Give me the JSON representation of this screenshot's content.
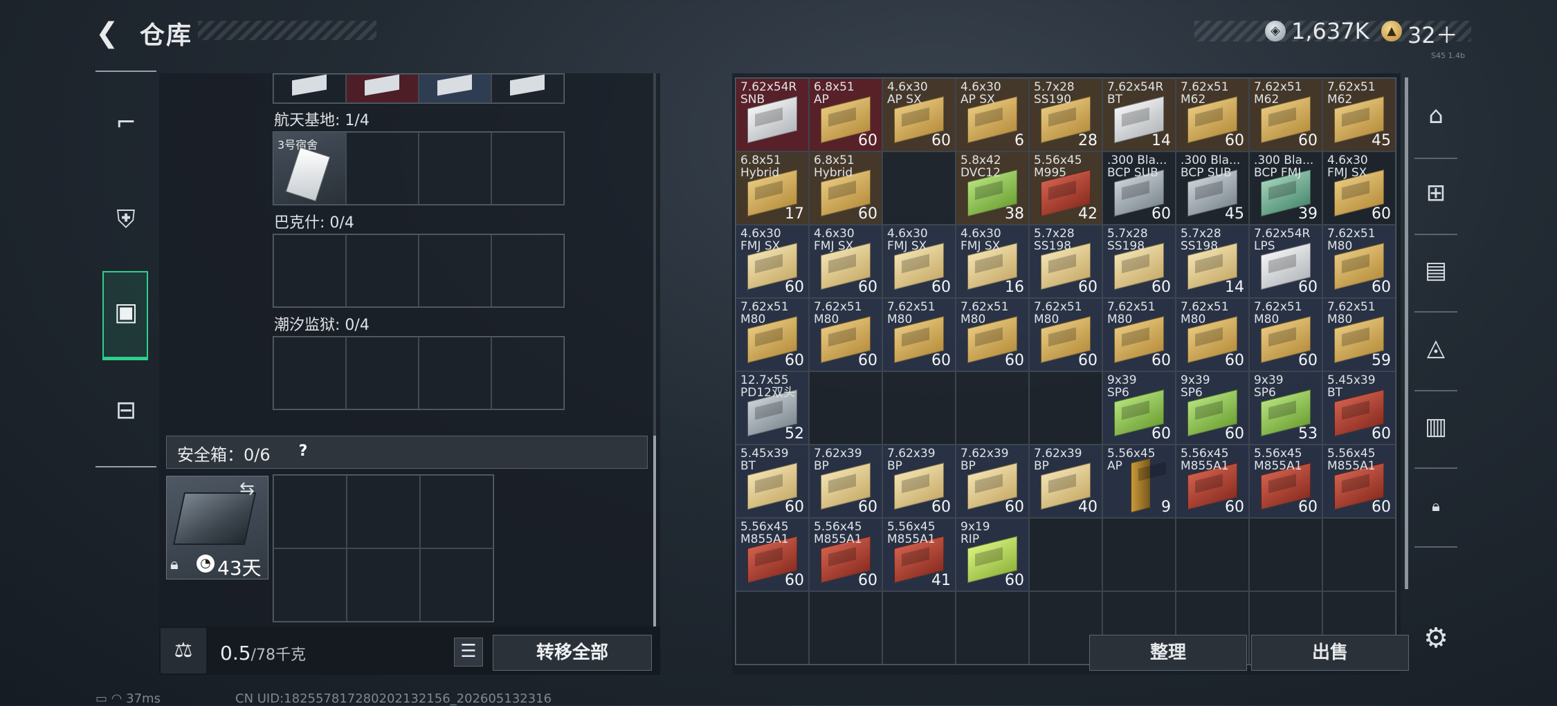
{
  "header": {
    "back_icon": "❮",
    "title": "仓库",
    "currency1_value": "1,637K",
    "currency2_value": "32＋",
    "version_text": "S45 1.4b"
  },
  "sidebar": {
    "items": [
      "weapons",
      "armor",
      "backpack",
      "toolbox"
    ]
  },
  "left_panel": {
    "sections": [
      {
        "label": "航天基地: 1/4"
      },
      {
        "label": "巴克什: 0/4"
      },
      {
        "label": "潮汐监狱: 0/4"
      }
    ],
    "key_item_label": "3号宿舍",
    "safe_box_label": "安全箱：0/6",
    "safe_help": "?",
    "safe_days": "43天",
    "weight_value": "0.5",
    "weight_capacity": "/78千克",
    "transfer_all": "转移全部"
  },
  "ammo_slots": [
    {
      "name": "7.62x54R\nSNB",
      "qty": "",
      "bg": "bg-red",
      "color": "c-white"
    },
    {
      "name": "6.8x51\nAP",
      "qty": "60",
      "bg": "bg-red",
      "color": "c-tan"
    },
    {
      "name": "4.6x30\nAP SX",
      "qty": "60",
      "bg": "bg-brown",
      "color": "c-tan"
    },
    {
      "name": "4.6x30\nAP SX",
      "qty": "6",
      "bg": "bg-brown",
      "color": "c-tan"
    },
    {
      "name": "5.7x28\nSS190",
      "qty": "28",
      "bg": "bg-brown",
      "color": "c-tan"
    },
    {
      "name": "7.62x54R\nBT",
      "qty": "14",
      "bg": "bg-brown",
      "color": "c-white"
    },
    {
      "name": "7.62x51\nM62",
      "qty": "60",
      "bg": "bg-brown",
      "color": "c-tan"
    },
    {
      "name": "7.62x51\nM62",
      "qty": "60",
      "bg": "bg-brown",
      "color": "c-tan"
    },
    {
      "name": "7.62x51\nM62",
      "qty": "45",
      "bg": "bg-brown",
      "color": "c-tan"
    },
    {
      "name": "6.8x51\nHybrid",
      "qty": "17",
      "bg": "bg-brown",
      "color": "c-tan"
    },
    {
      "name": "6.8x51\nHybrid",
      "qty": "60",
      "bg": "bg-brown",
      "color": "c-tan"
    },
    {
      "name": "",
      "qty": "",
      "bg": "bg-dark",
      "color": ""
    },
    {
      "name": "5.8x42\nDVC12",
      "qty": "38",
      "bg": "bg-brown",
      "color": "c-green"
    },
    {
      "name": "5.56x45\nM995",
      "qty": "42",
      "bg": "bg-brown",
      "color": "c-red"
    },
    {
      "name": ".300 Bla...\nBCP SUB",
      "qty": "60",
      "bg": "bg-dark",
      "color": "c-gray"
    },
    {
      "name": ".300 Bla...\nBCP SUB",
      "qty": "45",
      "bg": "bg-dark",
      "color": "c-gray"
    },
    {
      "name": ".300 Bla...\nBCP FMJ",
      "qty": "39",
      "bg": "bg-dark",
      "color": "c-teal"
    },
    {
      "name": "4.6x30\nFMJ SX",
      "qty": "60",
      "bg": "bg-dark",
      "color": "c-tan"
    },
    {
      "name": "4.6x30\nFMJ SX",
      "qty": "60",
      "bg": "bg-blue",
      "color": "c-ltan"
    },
    {
      "name": "4.6x30\nFMJ SX",
      "qty": "60",
      "bg": "bg-blue",
      "color": "c-ltan"
    },
    {
      "name": "4.6x30\nFMJ SX",
      "qty": "60",
      "bg": "bg-blue",
      "color": "c-ltan"
    },
    {
      "name": "4.6x30\nFMJ SX",
      "qty": "16",
      "bg": "bg-blue",
      "color": "c-ltan"
    },
    {
      "name": "5.7x28\nSS198",
      "qty": "60",
      "bg": "bg-blue",
      "color": "c-ltan"
    },
    {
      "name": "5.7x28\nSS198",
      "qty": "60",
      "bg": "bg-blue",
      "color": "c-ltan"
    },
    {
      "name": "5.7x28\nSS198",
      "qty": "14",
      "bg": "bg-blue",
      "color": "c-ltan"
    },
    {
      "name": "7.62x54R\nLPS",
      "qty": "60",
      "bg": "bg-blue",
      "color": "c-white"
    },
    {
      "name": "7.62x51\nM80",
      "qty": "60",
      "bg": "bg-blue",
      "color": "c-tan"
    },
    {
      "name": "7.62x51\nM80",
      "qty": "60",
      "bg": "bg-blue",
      "color": "c-tan"
    },
    {
      "name": "7.62x51\nM80",
      "qty": "60",
      "bg": "bg-blue",
      "color": "c-tan"
    },
    {
      "name": "7.62x51\nM80",
      "qty": "60",
      "bg": "bg-blue",
      "color": "c-tan"
    },
    {
      "name": "7.62x51\nM80",
      "qty": "60",
      "bg": "bg-blue",
      "color": "c-tan"
    },
    {
      "name": "7.62x51\nM80",
      "qty": "60",
      "bg": "bg-blue",
      "color": "c-tan"
    },
    {
      "name": "7.62x51\nM80",
      "qty": "60",
      "bg": "bg-blue",
      "color": "c-tan"
    },
    {
      "name": "7.62x51\nM80",
      "qty": "60",
      "bg": "bg-blue",
      "color": "c-tan"
    },
    {
      "name": "7.62x51\nM80",
      "qty": "60",
      "bg": "bg-blue",
      "color": "c-tan"
    },
    {
      "name": "7.62x51\nM80",
      "qty": "59",
      "bg": "bg-blue",
      "color": "c-tan"
    },
    {
      "name": "12.7x55\nPD12双头",
      "qty": "52",
      "bg": "bg-blue",
      "color": "c-gray"
    },
    {
      "name": "",
      "qty": "",
      "bg": "bg-dark",
      "color": ""
    },
    {
      "name": "",
      "qty": "",
      "bg": "bg-dark",
      "color": ""
    },
    {
      "name": "",
      "qty": "",
      "bg": "bg-dark",
      "color": ""
    },
    {
      "name": "",
      "qty": "",
      "bg": "bg-dark",
      "color": ""
    },
    {
      "name": "9x39\nSP6",
      "qty": "60",
      "bg": "bg-blue",
      "color": "c-green"
    },
    {
      "name": "9x39\nSP6",
      "qty": "60",
      "bg": "bg-blue",
      "color": "c-green"
    },
    {
      "name": "9x39\nSP6",
      "qty": "53",
      "bg": "bg-blue",
      "color": "c-green"
    },
    {
      "name": "5.45x39\nBT",
      "qty": "60",
      "bg": "bg-blue",
      "color": "c-red"
    },
    {
      "name": "5.45x39\nBT",
      "qty": "60",
      "bg": "bg-blue",
      "color": "c-ltan"
    },
    {
      "name": "7.62x39\nBP",
      "qty": "60",
      "bg": "bg-blue",
      "color": "c-ltan"
    },
    {
      "name": "7.62x39\nBP",
      "qty": "60",
      "bg": "bg-blue",
      "color": "c-ltan"
    },
    {
      "name": "7.62x39\nBP",
      "qty": "60",
      "bg": "bg-blue",
      "color": "c-ltan"
    },
    {
      "name": "7.62x39\nBP",
      "qty": "40",
      "bg": "bg-blue",
      "color": "c-ltan"
    },
    {
      "name": "5.56x45\nAP",
      "qty": "9",
      "bg": "bg-blue",
      "color": "c-bullet"
    },
    {
      "name": "5.56x45\nM855A1",
      "qty": "60",
      "bg": "bg-blue",
      "color": "c-red"
    },
    {
      "name": "5.56x45\nM855A1",
      "qty": "60",
      "bg": "bg-blue",
      "color": "c-red"
    },
    {
      "name": "5.56x45\nM855A1",
      "qty": "60",
      "bg": "bg-blue",
      "color": "c-red"
    },
    {
      "name": "5.56x45\nM855A1",
      "qty": "60",
      "bg": "bg-blue",
      "color": "c-red"
    },
    {
      "name": "5.56x45\nM855A1",
      "qty": "60",
      "bg": "bg-blue",
      "color": "c-red"
    },
    {
      "name": "5.56x45\nM855A1",
      "qty": "41",
      "bg": "bg-blue",
      "color": "c-red"
    },
    {
      "name": "9x19\nRIP",
      "qty": "60",
      "bg": "bg-blue",
      "color": "c-lime"
    },
    {
      "name": "",
      "qty": "",
      "bg": "bg-dark",
      "color": ""
    },
    {
      "name": "",
      "qty": "",
      "bg": "bg-dark",
      "color": ""
    },
    {
      "name": "",
      "qty": "",
      "bg": "bg-dark",
      "color": ""
    },
    {
      "name": "",
      "qty": "",
      "bg": "bg-dark",
      "color": ""
    },
    {
      "name": "",
      "qty": "",
      "bg": "bg-dark",
      "color": ""
    },
    {
      "name": "",
      "qty": "",
      "bg": "bg-dark",
      "color": ""
    },
    {
      "name": "",
      "qty": "",
      "bg": "bg-dark",
      "color": ""
    },
    {
      "name": "",
      "qty": "",
      "bg": "bg-dark",
      "color": ""
    },
    {
      "name": "",
      "qty": "",
      "bg": "bg-dark",
      "color": ""
    },
    {
      "name": "",
      "qty": "",
      "bg": "bg-dark",
      "color": ""
    },
    {
      "name": "",
      "qty": "",
      "bg": "bg-dark",
      "color": ""
    },
    {
      "name": "",
      "qty": "",
      "bg": "bg-dark",
      "color": ""
    },
    {
      "name": "",
      "qty": "",
      "bg": "bg-dark",
      "color": ""
    },
    {
      "name": "",
      "qty": "",
      "bg": "bg-dark",
      "color": ""
    }
  ],
  "buttons": {
    "tidy": "整理",
    "sell": "出售"
  },
  "right_sidebar": {
    "icons": [
      "base-icon",
      "add-container-icon",
      "ticket-icon",
      "crate-icon",
      "folder-iv-icon",
      "lock-icon"
    ]
  },
  "status": {
    "ping": "37ms",
    "uid": "CN UID:182557817280202132156_202605132316"
  },
  "colors": {
    "accent": "#2fd08c"
  }
}
